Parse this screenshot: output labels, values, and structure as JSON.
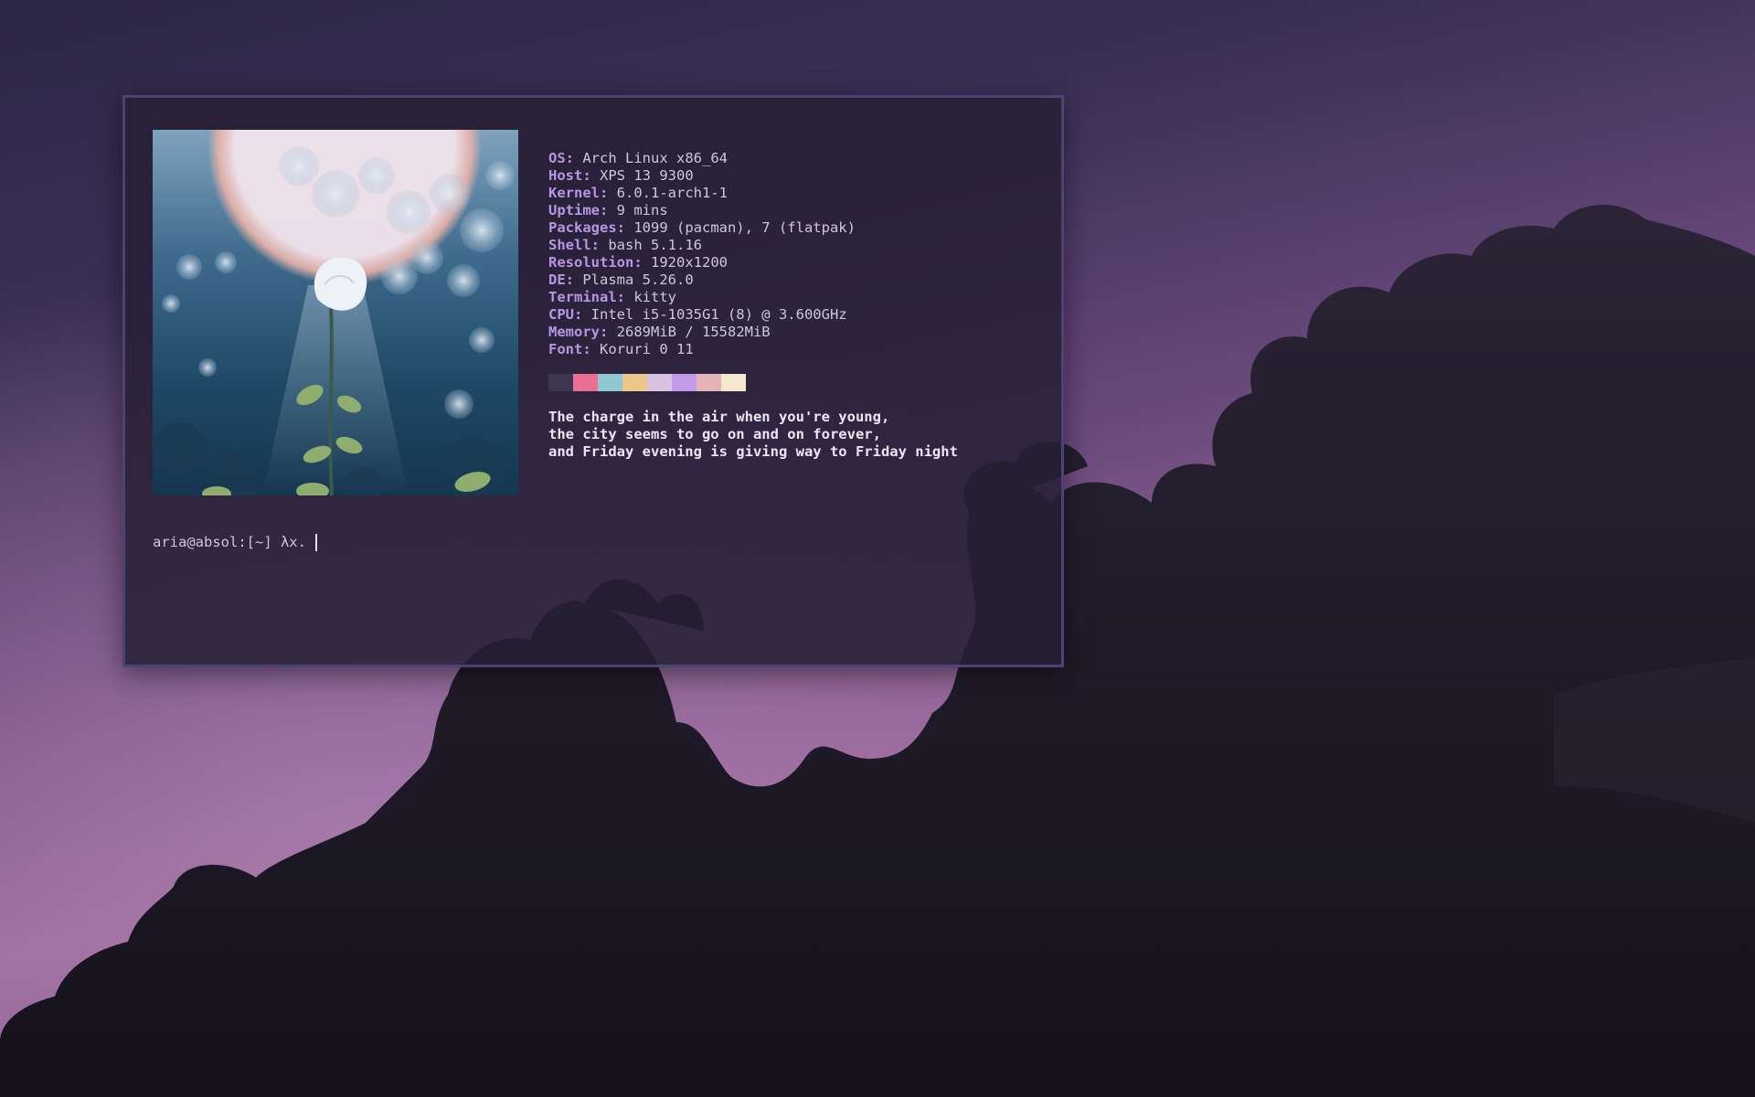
{
  "desktop": {
    "wallpaper": "purple-sky-clouds"
  },
  "terminal": {
    "app": "kitty",
    "info": [
      {
        "key": "OS",
        "value": "Arch Linux x86_64"
      },
      {
        "key": "Host",
        "value": "XPS 13 9300"
      },
      {
        "key": "Kernel",
        "value": "6.0.1-arch1-1"
      },
      {
        "key": "Uptime",
        "value": "9 mins"
      },
      {
        "key": "Packages",
        "value": "1099 (pacman), 7 (flatpak)"
      },
      {
        "key": "Shell",
        "value": "bash 5.1.16"
      },
      {
        "key": "Resolution",
        "value": "1920x1200"
      },
      {
        "key": "DE",
        "value": "Plasma 5.26.0"
      },
      {
        "key": "Terminal",
        "value": "kitty"
      },
      {
        "key": "CPU",
        "value": "Intel i5-1035G1 (8) @ 3.600GHz"
      },
      {
        "key": "Memory",
        "value": "2689MiB / 15582MiB"
      },
      {
        "key": "Font",
        "value": "Koruri 0 11"
      }
    ],
    "palette": [
      "#3d3650",
      "#ea7093",
      "#8fc7d3",
      "#ecc68a",
      "#d8c3e0",
      "#c39bea",
      "#e4b3b8",
      "#f6e7cf"
    ],
    "quote": [
      "The charge in the air when you're young,",
      "the city seems to go on and on forever,",
      "and Friday evening is giving way to Friday night"
    ],
    "prompt": "aria@absol:[~] λx."
  },
  "colors": {
    "accent_key": "#b796e3",
    "window_border": "#4d4373",
    "window_bg": "#262034"
  }
}
